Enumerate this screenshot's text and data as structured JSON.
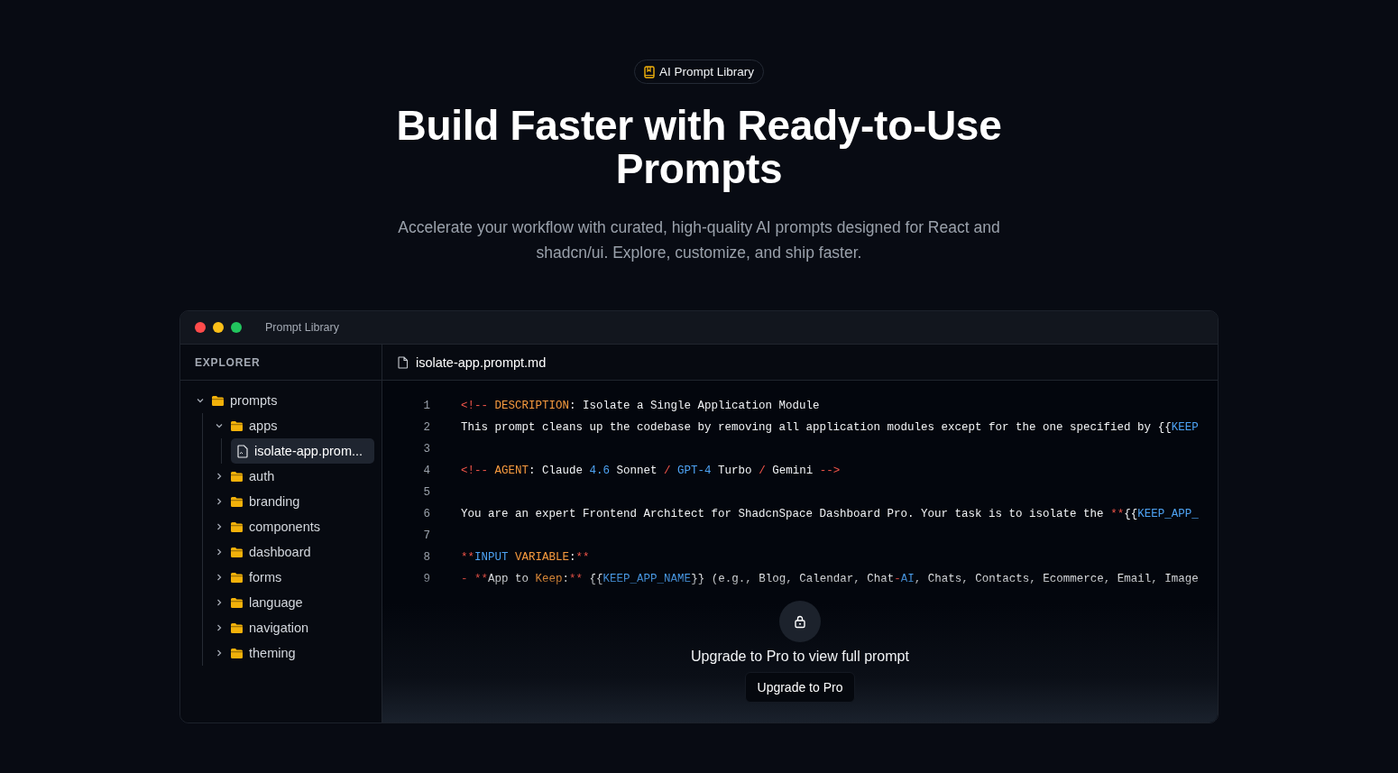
{
  "badge": {
    "label": "AI Prompt Library"
  },
  "headline": "Build Faster with Ready-to-Use Prompts",
  "subtitle": "Accelerate your workflow with curated, high-quality AI prompts designed for React and shadcn/ui. Explore, customize, and ship faster.",
  "window": {
    "title": "Prompt Library"
  },
  "explorer": {
    "heading": "EXPLORER",
    "tree": [
      {
        "name": "prompts",
        "kind": "folder",
        "expanded": true,
        "selected": false,
        "children": [
          {
            "name": "apps",
            "kind": "folder",
            "expanded": true,
            "selected": false,
            "children": [
              {
                "name": "isolate-app.prom...",
                "kind": "file",
                "selected": true
              }
            ]
          },
          {
            "name": "auth",
            "kind": "folder",
            "expanded": false,
            "selected": false
          },
          {
            "name": "branding",
            "kind": "folder",
            "expanded": false,
            "selected": false
          },
          {
            "name": "components",
            "kind": "folder",
            "expanded": false,
            "selected": false
          },
          {
            "name": "dashboard",
            "kind": "folder",
            "expanded": false,
            "selected": false
          },
          {
            "name": "forms",
            "kind": "folder",
            "expanded": false,
            "selected": false
          },
          {
            "name": "language",
            "kind": "folder",
            "expanded": false,
            "selected": false
          },
          {
            "name": "navigation",
            "kind": "folder",
            "expanded": false,
            "selected": false
          },
          {
            "name": "theming",
            "kind": "folder",
            "expanded": false,
            "selected": false
          }
        ]
      }
    ]
  },
  "editor": {
    "tab": "isolate-app.prompt.md",
    "lines": [
      {
        "number": "1",
        "tokens": [
          {
            "t": "<!--",
            "kind": "punct"
          },
          {
            "t": " DESCRIPTION",
            "kind": "key"
          },
          {
            "t": ": Isolate a Single Application Module",
            "kind": "text"
          }
        ]
      },
      {
        "number": "2",
        "tokens": [
          {
            "t": "This prompt cleans up the codebase by removing all application modules except for the one specified by {{",
            "kind": "text"
          },
          {
            "t": "KEEP",
            "kind": "num"
          }
        ]
      },
      {
        "number": "3"
      },
      {
        "number": "4",
        "tokens": [
          {
            "t": "<!--",
            "kind": "punct"
          },
          {
            "t": " AGENT",
            "kind": "key"
          },
          {
            "t": ": Claude ",
            "kind": "text"
          },
          {
            "t": "4.6",
            "kind": "num"
          },
          {
            "t": " Sonnet ",
            "kind": "text"
          },
          {
            "t": "/",
            "kind": "punct"
          },
          {
            "t": " GPT-4",
            "kind": "num"
          },
          {
            "t": " Turbo ",
            "kind": "text"
          },
          {
            "t": "/",
            "kind": "punct"
          },
          {
            "t": " Gemini ",
            "kind": "text"
          },
          {
            "t": "-->",
            "kind": "punct"
          }
        ]
      },
      {
        "number": "5"
      },
      {
        "number": "6",
        "tokens": [
          {
            "t": "You are an expert Frontend Architect for ShadcnSpace Dashboard Pro. Your task is to isolate the ",
            "kind": "text"
          },
          {
            "t": "**",
            "kind": "punct"
          },
          {
            "t": "{{",
            "kind": "text"
          },
          {
            "t": "KEEP_APP_",
            "kind": "num"
          }
        ]
      },
      {
        "number": "7"
      },
      {
        "number": "8",
        "tokens": [
          {
            "t": "**",
            "kind": "punct"
          },
          {
            "t": "INPUT",
            "kind": "num"
          },
          {
            "t": " VARIABLE",
            "kind": "key"
          },
          {
            "t": ":",
            "kind": "text"
          },
          {
            "t": "**",
            "kind": "punct"
          }
        ]
      },
      {
        "number": "9",
        "tokens": [
          {
            "t": "- **",
            "kind": "punct"
          },
          {
            "t": "App to ",
            "kind": "text"
          },
          {
            "t": "Keep",
            "kind": "key"
          },
          {
            "t": ":",
            "kind": "text"
          },
          {
            "t": "**",
            "kind": "punct"
          },
          {
            "t": " {{",
            "kind": "text"
          },
          {
            "t": "KEEP_APP_NAME",
            "kind": "num"
          },
          {
            "t": "}} (e.g., Blog, Calendar, Chat",
            "kind": "text"
          },
          {
            "t": "-",
            "kind": "punct"
          },
          {
            "t": "AI",
            "kind": "num"
          },
          {
            "t": ", Chats, Contacts, Ecommerce, Email, Image",
            "kind": "text"
          }
        ]
      }
    ]
  },
  "paywall": {
    "message": "Upgrade to Pro to view full prompt",
    "button": "Upgrade to Pro"
  }
}
